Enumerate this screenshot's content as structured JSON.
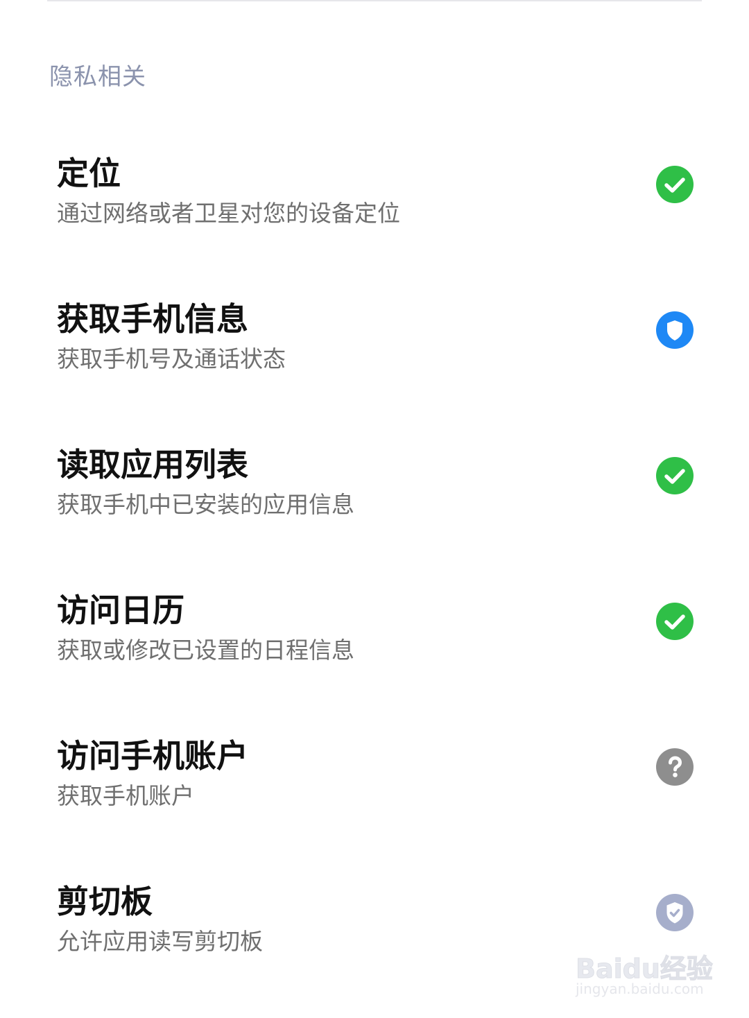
{
  "section": {
    "header": "隐私相关"
  },
  "permissions": [
    {
      "title": "定位",
      "desc": "通过网络或者卫星对您的设备定位",
      "status": "allowed",
      "icon": "check-circle-icon"
    },
    {
      "title": "获取手机信息",
      "desc": "获取手机号及通话状态",
      "status": "protected",
      "icon": "shield-icon"
    },
    {
      "title": "读取应用列表",
      "desc": "获取手机中已安装的应用信息",
      "status": "allowed",
      "icon": "check-circle-icon"
    },
    {
      "title": "访问日历",
      "desc": "获取或修改已设置的日程信息",
      "status": "allowed",
      "icon": "check-circle-icon"
    },
    {
      "title": "访问手机账户",
      "desc": "获取手机账户",
      "status": "ask",
      "icon": "question-circle-icon"
    },
    {
      "title": "剪切板",
      "desc": "允许应用读写剪切板",
      "status": "allowed-when-in-use",
      "icon": "shield-check-icon"
    }
  ],
  "colors": {
    "allowed": "#2fbf47",
    "protected": "#1e88f5",
    "ask": "#8e8e8e",
    "allowed_when_in_use": "#a6aecb",
    "section_header": "#8b93ad"
  },
  "watermark": {
    "logo": "Baidu经验",
    "url": "jingyan.baidu.com"
  }
}
